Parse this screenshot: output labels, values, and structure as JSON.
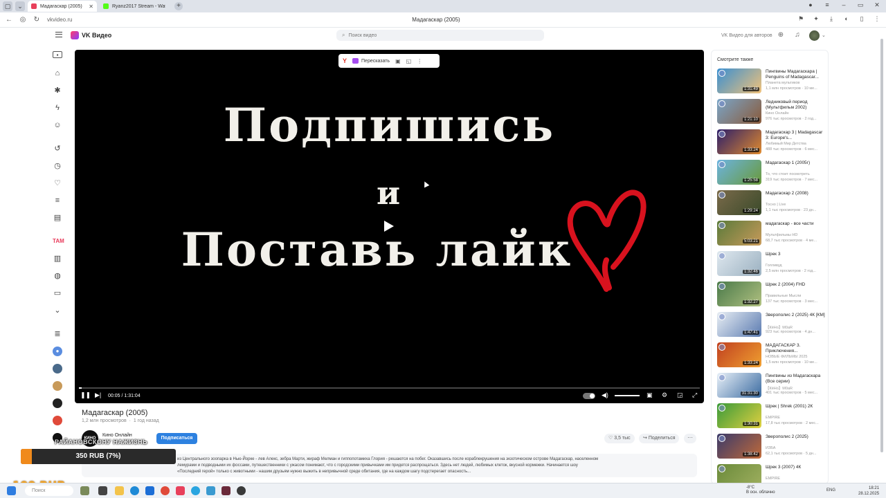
{
  "browser": {
    "tabs": [
      {
        "label": "Мадагаскар (2005)",
        "color": "#e8405b"
      },
      {
        "label": "Ryanz2017 Stream - Watc",
        "color": "#53fc18"
      }
    ],
    "url": "vkvideo.ru",
    "page_title": "Мадагаскар (2005)"
  },
  "header": {
    "app_name": "VK Видео",
    "search_placeholder": "Поиск видео",
    "authors_link": "VK Видео для авторов"
  },
  "player": {
    "overlay": {
      "retell_label": "Пересказать"
    },
    "slide_lines": [
      "Подпишись",
      "и",
      "Поставь лайк"
    ],
    "time": "00:05 / 1:31:04",
    "progress_fraction": 0.001,
    "volume_fraction": 1.0
  },
  "video": {
    "title": "Мадагаскар (2005)",
    "views": "1,2 млн просмотров",
    "age": "1 год назад",
    "channel_avatar_text": "КИНО",
    "channel_name": "Кино Онлайн",
    "subscribe_label": "Подписаться",
    "likes": "3,5 тыс",
    "share_label": "Поделиться",
    "description": "из Центрального зоопарка в Нью-Йорке - лев Алекс, зебра Марти, жираф Мелман и гиппопотамиха Глория - решаются на побег. Оказавшись после кораблекрушения на экзотическом острове Мадагаскар, населенном лемурами и подводными их фоссами, путешественники с ужасом понимают, что с городскими привычками им придется распрощаться. Здесь нет людей, любимых клеток, вкусной кормежки. Начинается шоу «Последний герой» только с животными - нашим друзьям нужно выжить в непривычной среде обитания, где на каждом шагу подстерегает опасность..."
  },
  "stream": {
    "scroll_text": "РАЙАНОВСКОНУ НАЖИЗНЬ",
    "donate_text": "350 RUB (7%)",
    "donate_fraction": 0.07,
    "goal_text": "100 RUB"
  },
  "recommendations": {
    "title": "Смотрите также",
    "items": [
      {
        "title": "Пингвины Мадагаскара | Penguins of Madagascar...",
        "channel": "Планета мультиков",
        "meta": "1,1 млн просмотров · 10 ме...",
        "duration": "1:31:49",
        "thumb": [
          "#3a8fd0",
          "#f1c27a"
        ]
      },
      {
        "title": "Ледниковый период (Мультфильм 2002)",
        "channel": "Кино Онлайн",
        "meta": "976 тыс просмотров · 2 год...",
        "duration": "1:21:10",
        "thumb": [
          "#7aa5c8",
          "#8a5a3a"
        ]
      },
      {
        "title": "Мадагаскар 3 | Madagascar 3: Europe's...",
        "channel": "Любимый Мир Детства",
        "meta": "488 тыс просмотров · 6 мес...",
        "duration": "1:33:24",
        "thumb": [
          "#2c1e6a",
          "#e08a2e"
        ]
      },
      {
        "title": "Мадагаскар 1 (2005г)",
        "channel": "То, что стоит посмотреть",
        "meta": "319 тыс просмотров · 7 мес...",
        "duration": "1:25:58",
        "thumb": [
          "#6bb3e0",
          "#6a9a3a"
        ]
      },
      {
        "title": "Мадагаскар 2 (2008)",
        "channel": "Тосно | Live",
        "meta": "1,1 тыс просмотров · 23 дн...",
        "duration": "1:29:24",
        "thumb": [
          "#7a6a4a",
          "#3a4a2a"
        ]
      },
      {
        "title": "мадагаскар - все части",
        "channel": "Мультфильмы HD",
        "meta": "68,7 тыс просмотров · 4 ме...",
        "duration": "5:03:21",
        "thumb": [
          "#5a7a3a",
          "#c89a5a"
        ]
      },
      {
        "title": "Шрек 3",
        "channel": "Голливуд",
        "meta": "2,5 млн просмотров · 2 год...",
        "duration": "1:32:46",
        "thumb": [
          "#dfe8ef",
          "#9ab0c0"
        ]
      },
      {
        "title": "Шрек 2 (2004) FHD",
        "channel": "Правильные Мысли",
        "meta": "137 тыс просмотров · 3 мес...",
        "duration": "1:32:27",
        "thumb": [
          "#4a7a4a",
          "#b0c080"
        ]
      },
      {
        "title": "Зверополис 2 (2025) 4К [КМ]",
        "channel": "【КёНо】M0aR",
        "meta": "923 тыс просмотров · 4 дн...",
        "duration": "1:47:41",
        "thumb": [
          "#e8eef4",
          "#5a7ab0"
        ]
      },
      {
        "title": "МАДАГАСКАР 3. Приключения...",
        "channel": "НОВЫЕ ФИЛЬМЫ 2025",
        "meta": "1,5 млн просмотров · 10 ме...",
        "duration": "1:33:24",
        "thumb": [
          "#c04020",
          "#f0a030"
        ]
      },
      {
        "title": "Пингвины из Мадагаскара (Все серии)",
        "channel": "【КёНо】M0aR",
        "meta": "401 тыс просмотров · 5 мес...",
        "duration": "31:31:30",
        "thumb": [
          "#e8f0f8",
          "#3a6aa0"
        ]
      },
      {
        "title": "Шрек | Shrek (2001) 2К",
        "channel": "EMPIRE",
        "meta": "17,8 тыс просмотров · 2 мес...",
        "duration": "1:30:31",
        "thumb": [
          "#3a9a3a",
          "#e0d040"
        ]
      },
      {
        "title": "Зверополис 2 (2025)",
        "channel": "ИЗБА",
        "meta": "62,1 тыс просмотров · 5 дн...",
        "duration": "1:38:42",
        "thumb": [
          "#3a3a6a",
          "#c06a3a"
        ]
      },
      {
        "title": "Шрек 3 (2007) 4К",
        "channel": "EMPIRE",
        "meta": "",
        "duration": "",
        "thumb": [
          "#6a8a3a",
          "#a0b060"
        ]
      }
    ]
  },
  "taskbar": {
    "search_label": "Поиск",
    "weather_temp": "-8°C",
    "weather_desc": "В осн. облачно",
    "lang": "ENG",
    "time": "18:21",
    "date": "28.12.2025"
  }
}
